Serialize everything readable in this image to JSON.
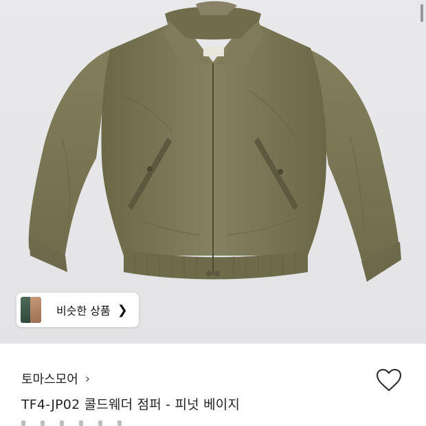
{
  "similar": {
    "label": "비슷한 상품",
    "arrow_icon": "chevron-right-icon"
  },
  "brand": {
    "name": "토마스모어",
    "arrow_icon": "chevron-right-icon"
  },
  "product": {
    "title": "TF4-JP02 콜드웨더 점퍼 - 피넛 베이지",
    "color_hex": "#7b7a55"
  },
  "wishlist": {
    "icon": "heart-outline-icon"
  },
  "colors": {
    "photo_bg": "#e8e8ea",
    "jacket": "#7b7a55"
  }
}
